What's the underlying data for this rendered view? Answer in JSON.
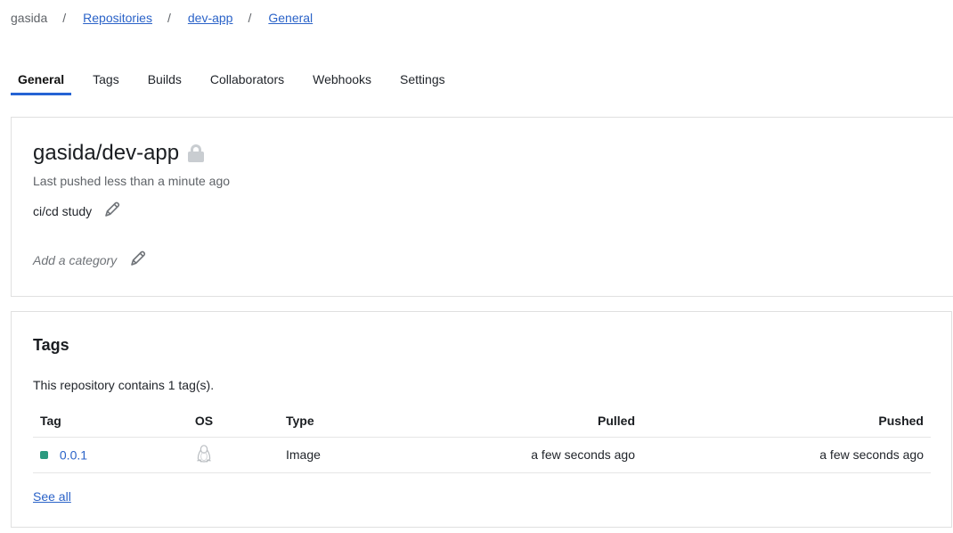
{
  "breadcrumb": {
    "user": "gasida",
    "sep": "/",
    "repositories": "Repositories",
    "repo": "dev-app",
    "current": "General"
  },
  "tabs": [
    "General",
    "Tags",
    "Builds",
    "Collaborators",
    "Webhooks",
    "Settings"
  ],
  "active_tab": "General",
  "repo": {
    "title": "gasida/dev-app",
    "last_pushed": "Last pushed less than a minute ago",
    "description": "ci/cd study",
    "category_placeholder": "Add a category",
    "lock_icon": "lock-icon"
  },
  "tags_section": {
    "title": "Tags",
    "count_text": "This repository contains 1 tag(s).",
    "columns": [
      "Tag",
      "OS",
      "Type",
      "Pulled",
      "Pushed"
    ],
    "rows": [
      {
        "tag": "0.0.1",
        "os_icon": "linux-icon",
        "type": "Image",
        "pulled": "a few seconds ago",
        "pushed": "a few seconds ago",
        "status_color": "#2b9a7f"
      }
    ],
    "see_all": "See all"
  },
  "colors": {
    "accent": "#2563d4",
    "link": "#2b63c8"
  }
}
